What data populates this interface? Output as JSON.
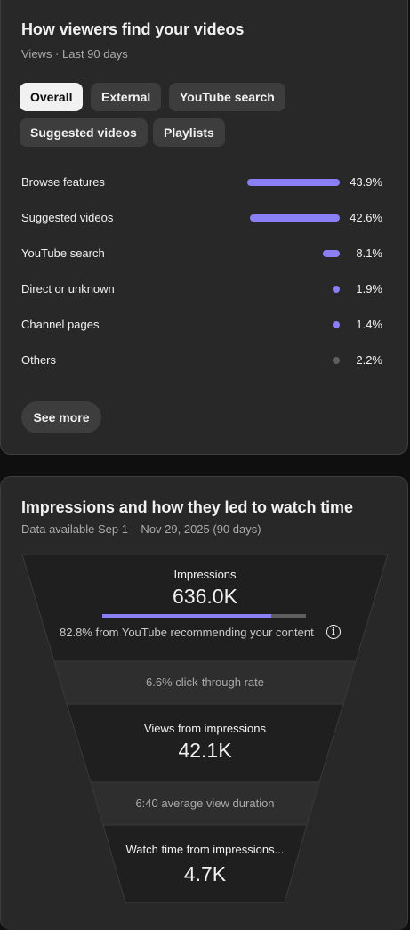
{
  "traffic": {
    "title": "How viewers find your videos",
    "subtitle": "Views · Last 90 days",
    "chips": [
      "Overall",
      "External",
      "YouTube search",
      "Suggested videos",
      "Playlists"
    ],
    "rows": [
      {
        "label": "Browse features",
        "pct": "43.9%",
        "value": 43.9,
        "mark": "bar"
      },
      {
        "label": "Suggested videos",
        "pct": "42.6%",
        "value": 42.6,
        "mark": "bar"
      },
      {
        "label": "YouTube search",
        "pct": "8.1%",
        "value": 8.1,
        "mark": "bar"
      },
      {
        "label": "Direct or unknown",
        "pct": "1.9%",
        "value": 1.9,
        "mark": "dot"
      },
      {
        "label": "Channel pages",
        "pct": "1.4%",
        "value": 1.4,
        "mark": "dot"
      },
      {
        "label": "Others",
        "pct": "2.2%",
        "value": 2.2,
        "mark": "dot-grey"
      }
    ],
    "see_more": "See more",
    "accent": "#8b7ff5"
  },
  "impressions": {
    "title": "Impressions and how they led to watch time",
    "subtitle": "Data available Sep 1 – Nov 29, 2025 (90 days)",
    "impressions_label": "Impressions",
    "impressions_value": "636.0K",
    "recommend_share": 82.8,
    "recommend_text": "82.8% from YouTube recommending your content",
    "ctr_text": "6.6% click-through rate",
    "views_label": "Views from impressions",
    "views_value": "42.1K",
    "avd_text": "6:40 average view duration",
    "watch_label": "Watch time from impressions...",
    "watch_value": "4.7K"
  }
}
